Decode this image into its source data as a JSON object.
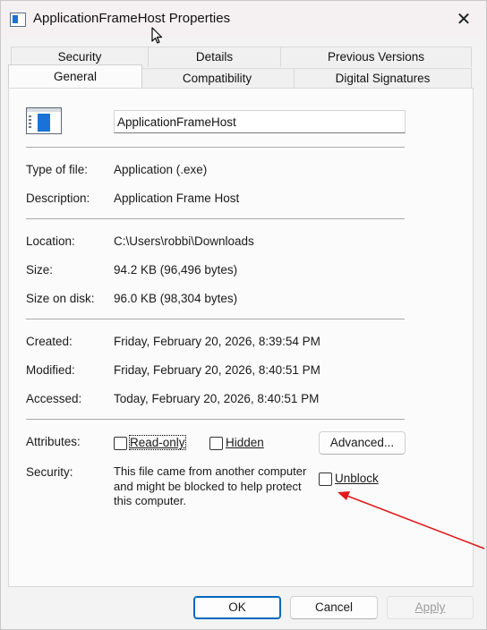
{
  "window": {
    "title": "ApplicationFrameHost Properties",
    "close_glyph": "✕"
  },
  "tabs": {
    "row1": [
      "Security",
      "Details",
      "Previous Versions"
    ],
    "row2": [
      "General",
      "Compatibility",
      "Digital Signatures"
    ],
    "active": "General"
  },
  "general": {
    "icon": "application-icon",
    "file_name": "ApplicationFrameHost",
    "type_of_file_label": "Type of file:",
    "type_of_file_value": "Application (.exe)",
    "description_label": "Description:",
    "description_value": "Application Frame Host",
    "location_label": "Location:",
    "location_value": "C:\\Users\\robbi\\Downloads",
    "size_label": "Size:",
    "size_value": "94.2 KB (96,496 bytes)",
    "size_on_disk_label": "Size on disk:",
    "size_on_disk_value": "96.0 KB (98,304 bytes)",
    "created_label": "Created:",
    "created_value": "Friday, February 20, 2026, 8:39:54 PM",
    "modified_label": "Modified:",
    "modified_value": "Friday, February 20, 2026, 8:40:51 PM",
    "accessed_label": "Accessed:",
    "accessed_value": "Today, February 20, 2026, 8:40:51 PM",
    "attributes_label": "Attributes:",
    "readonly_label": "Read-only",
    "readonly_checked": false,
    "hidden_label": "Hidden",
    "hidden_checked": false,
    "advanced_label": "Advanced...",
    "security_label": "Security:",
    "security_text": "This file came from another computer and might be blocked to help protect this computer.",
    "unblock_label": "Unblock",
    "unblock_checked": false
  },
  "footer": {
    "ok_label": "OK",
    "cancel_label": "Cancel",
    "apply_label": "Apply"
  },
  "annotation": {
    "arrow_color": "#e0191b"
  },
  "colors": {
    "accent": "#0067c0",
    "icon_blue": "#1a72d6"
  }
}
